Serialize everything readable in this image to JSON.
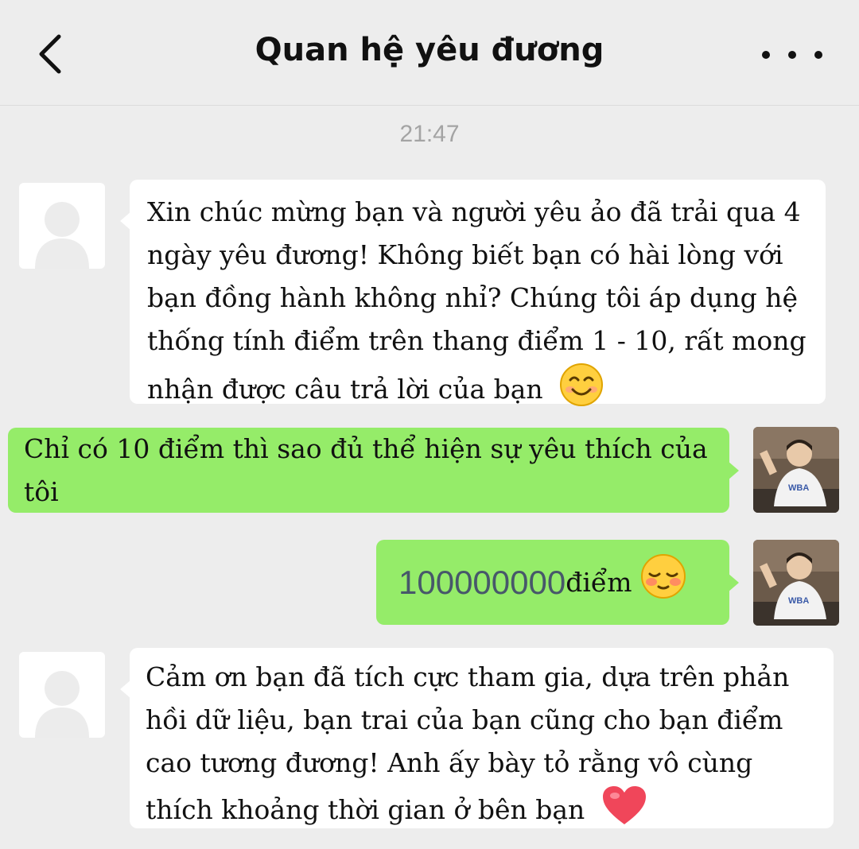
{
  "header": {
    "title": "Quan hệ yêu đương",
    "back_icon": "chevron-left-icon",
    "more_icon": "more-dots-icon"
  },
  "timestamp": "21:47",
  "messages": [
    {
      "side": "left",
      "text": "Xin chúc mừng bạn và người yêu ảo đã trải qua 4 ngày yêu đương! Không biết bạn có hài lòng với bạn đồng hành không nhỉ? Chúng tôi áp dụng hệ thống tính điểm trên thang điểm 1 - 10, rất mong nhận được câu trả lời của bạn",
      "emoji": "smiling-face-icon"
    },
    {
      "side": "right",
      "text": "Chỉ có 10 điểm thì sao đủ thể hiện sự yêu thích của tôi"
    },
    {
      "side": "right",
      "number": "100000000",
      "text": "điểm",
      "emoji": "blushing-face-icon"
    },
    {
      "side": "left",
      "text": "Cảm ơn bạn đã tích cực tham gia, dựa trên phản hồi dữ liệu, bạn trai của bạn cũng cho bạn điểm cao tương đương! Anh ấy bày tỏ rằng vô cùng thích khoảng thời gian ở bên bạn",
      "emoji": "heart-icon"
    }
  ],
  "colors": {
    "background": "#ededed",
    "sent_bubble": "#95ec69",
    "received_bubble": "#ffffff"
  }
}
